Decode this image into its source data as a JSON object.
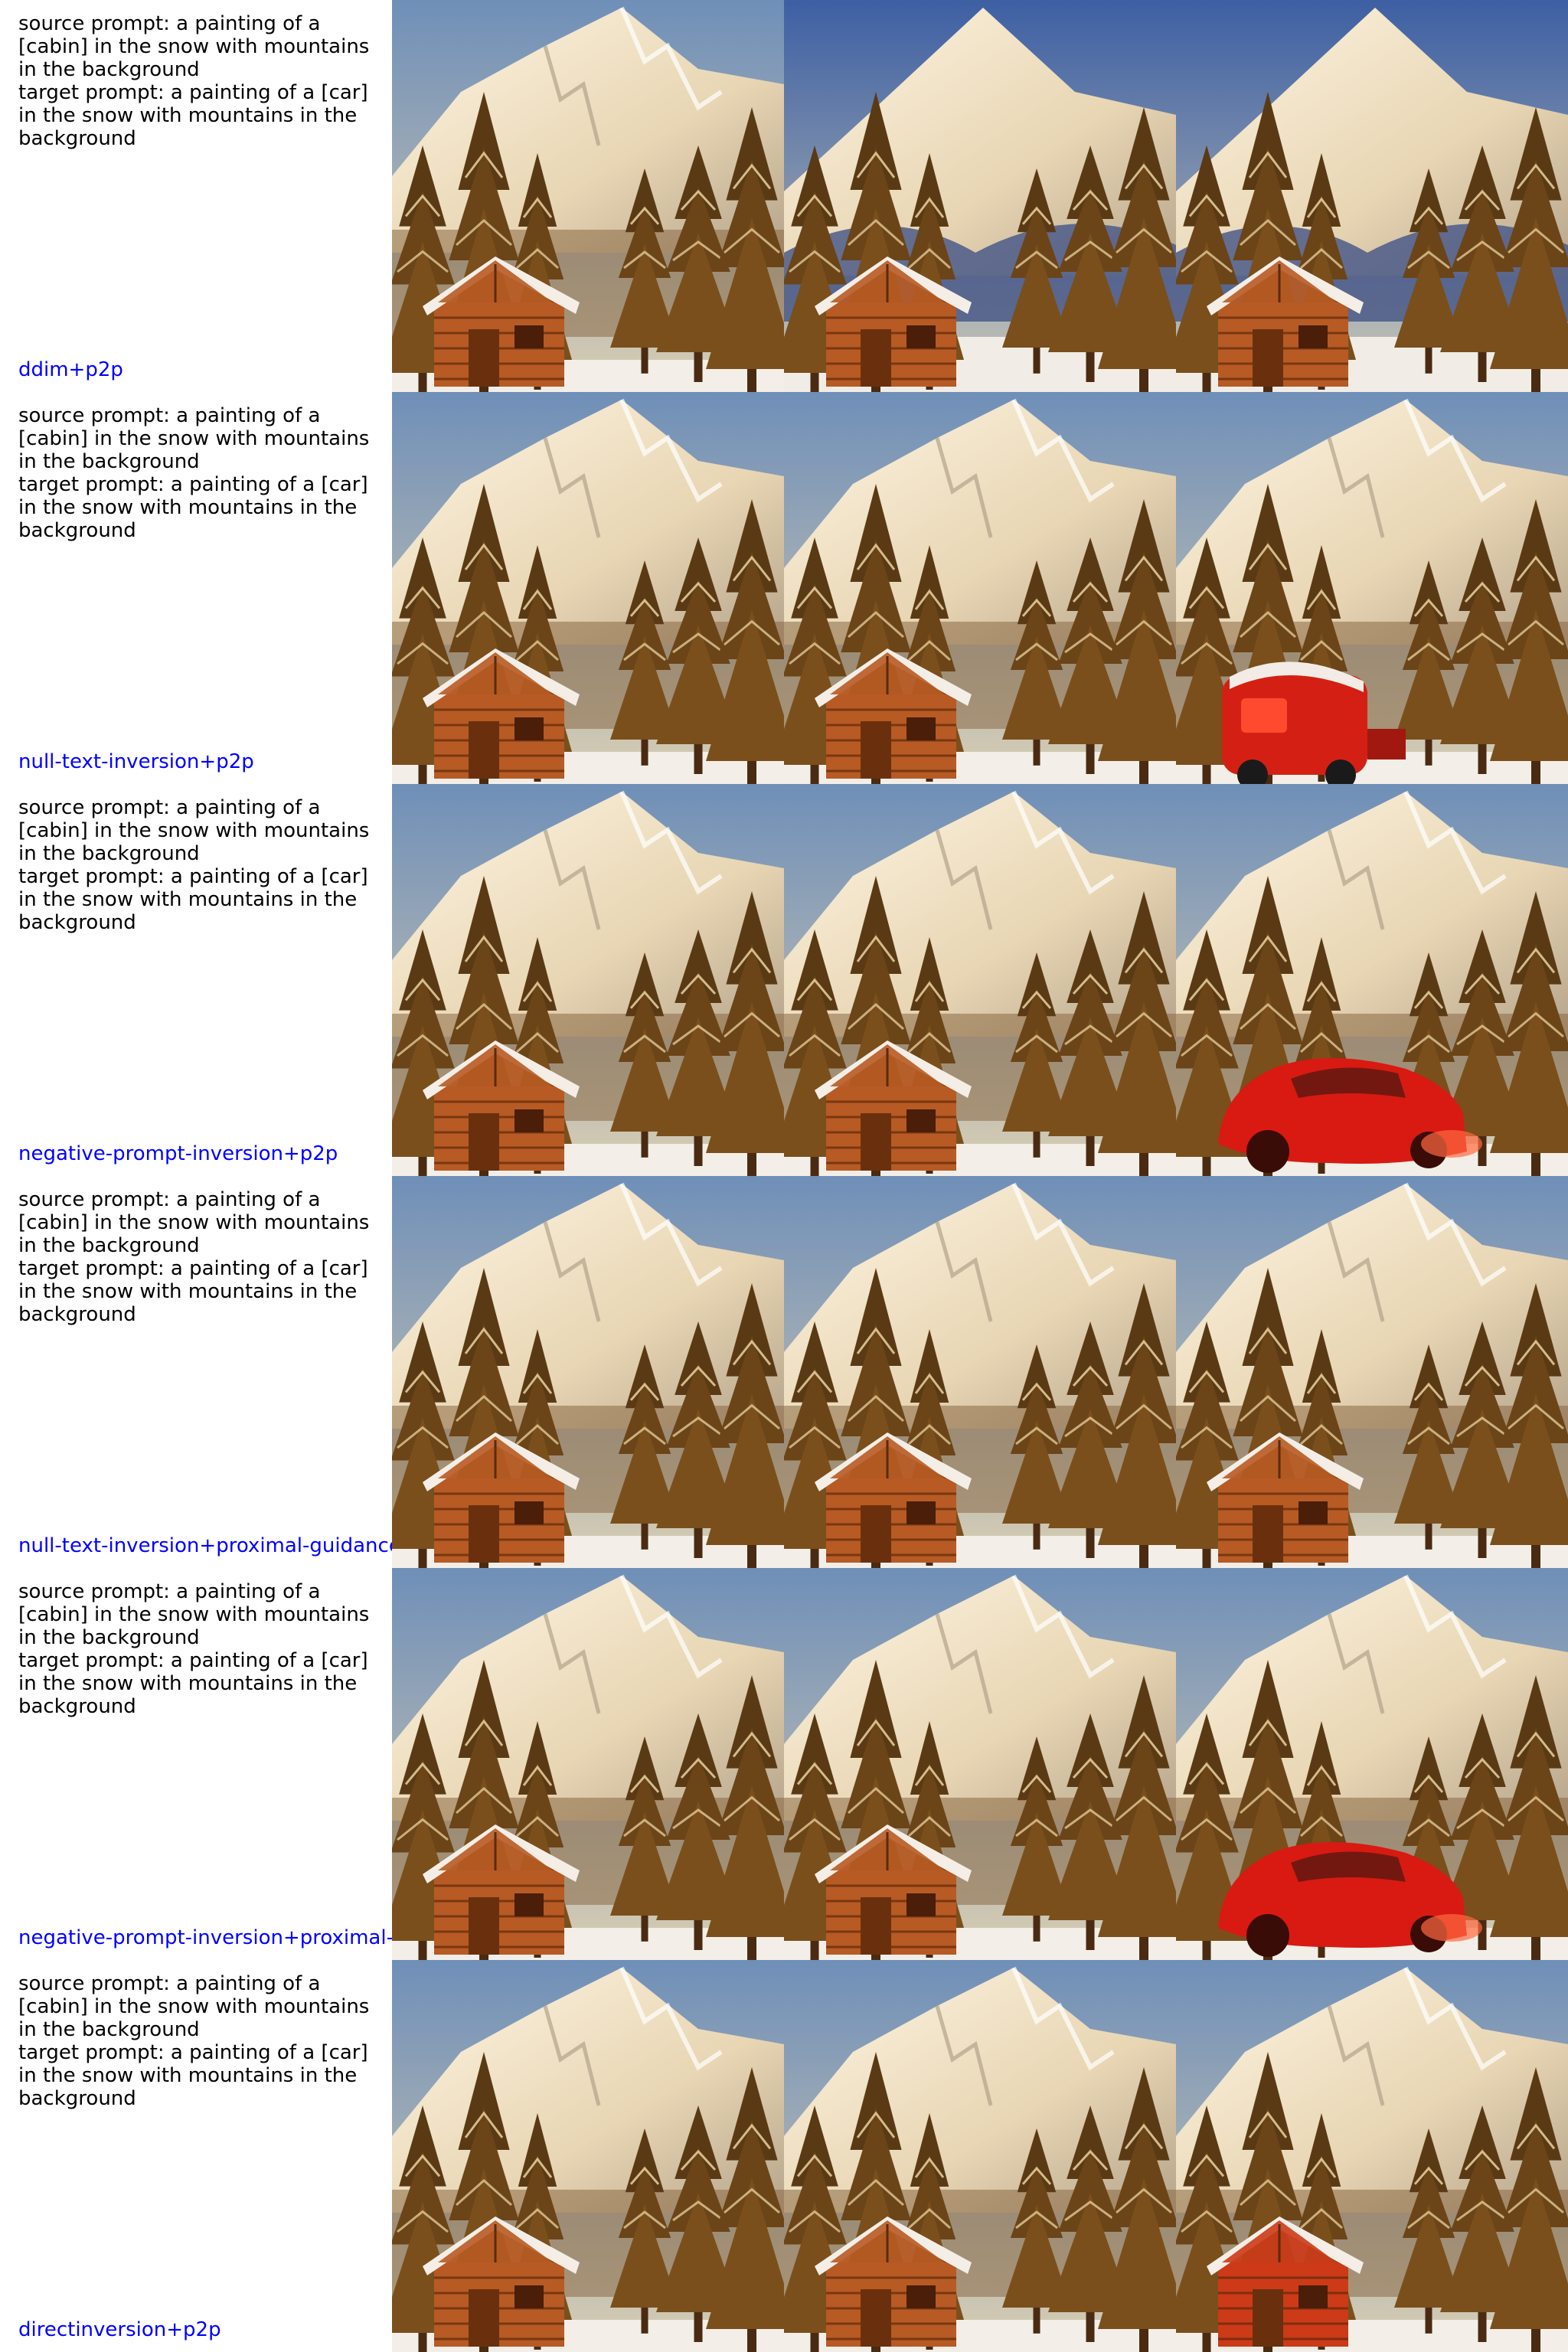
{
  "rows": [
    {
      "source_prompt": "source prompt: a painting of a [cabin] in the snow with mountains in the background",
      "target_prompt": "target prompt: a painting of a [car] in the snow with mountains in the background",
      "method": "ddim+p2p",
      "panels": [
        {
          "content": "cabin",
          "style": "light"
        },
        {
          "content": "cabin",
          "style": "blue"
        },
        {
          "content": "cabin",
          "style": "blue"
        }
      ]
    },
    {
      "source_prompt": "source prompt: a painting of a [cabin] in the snow with mountains in the background",
      "target_prompt": "target prompt: a painting of a [car] in the snow with mountains in the background",
      "method": "null-text-inversion+p2p",
      "panels": [
        {
          "content": "cabin",
          "style": "light"
        },
        {
          "content": "cabin",
          "style": "light"
        },
        {
          "content": "red-van",
          "style": "light"
        }
      ]
    },
    {
      "source_prompt": "source prompt: a painting of a [cabin] in the snow with mountains in the background",
      "target_prompt": "target prompt: a painting of a [car] in the snow with mountains in the background",
      "method": "negative-prompt-inversion+p2p",
      "panels": [
        {
          "content": "cabin",
          "style": "light"
        },
        {
          "content": "cabin",
          "style": "light"
        },
        {
          "content": "red-car",
          "style": "light"
        }
      ]
    },
    {
      "source_prompt": "source prompt: a painting of a [cabin] in the snow with mountains in the background",
      "target_prompt": "target prompt: a painting of a [car] in the snow with mountains in the background",
      "method": "null-text-inversion+proximal-guidance",
      "panels": [
        {
          "content": "cabin",
          "style": "light"
        },
        {
          "content": "cabin",
          "style": "light"
        },
        {
          "content": "cabin",
          "style": "light"
        }
      ]
    },
    {
      "source_prompt": "source prompt: a painting of a [cabin] in the snow with mountains in the background",
      "target_prompt": "target prompt: a painting of a [car] in the snow with mountains in the background",
      "method": "negative-prompt-inversion+proximal-guidance",
      "panels": [
        {
          "content": "cabin",
          "style": "light"
        },
        {
          "content": "cabin",
          "style": "light"
        },
        {
          "content": "red-car",
          "style": "light"
        }
      ]
    },
    {
      "source_prompt": "source prompt: a painting of a [cabin] in the snow with mountains in the background",
      "target_prompt": "target prompt: a painting of a [car] in the snow with mountains in the background",
      "method": "directinversion+p2p",
      "panels": [
        {
          "content": "cabin",
          "style": "light"
        },
        {
          "content": "cabin",
          "style": "light"
        },
        {
          "content": "red-cabin",
          "style": "light"
        }
      ]
    }
  ]
}
